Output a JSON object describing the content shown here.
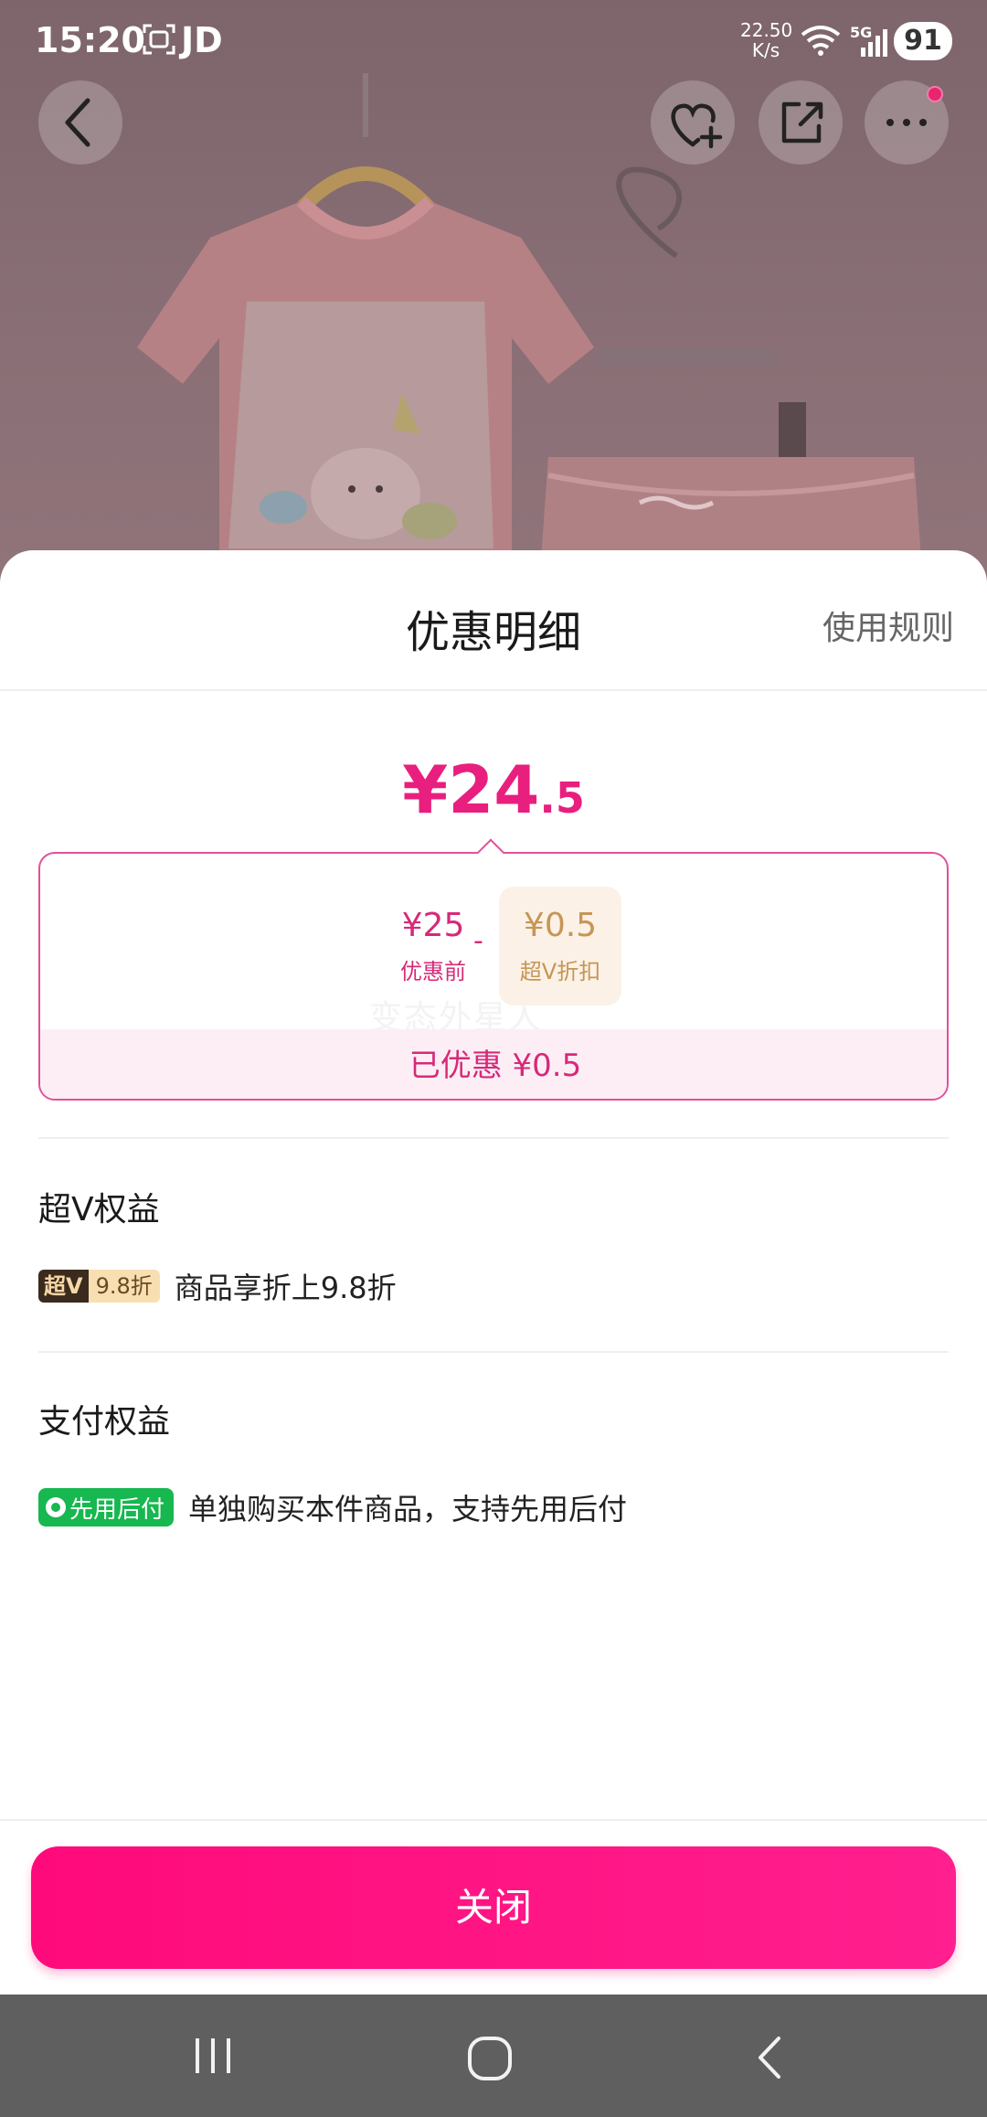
{
  "status_bar": {
    "time": "15:20",
    "carrier": "JD",
    "speed_value": "22.50",
    "speed_unit": "K/s",
    "network": "5G",
    "battery": "91"
  },
  "sheet": {
    "title": "优惠明细",
    "rules_link": "使用规则",
    "final_price_int": "¥24",
    "final_price_dec": ".5",
    "calc": {
      "original_value": "¥25",
      "original_label": "优惠前",
      "minus": "-",
      "discount_value": "¥0.5",
      "discount_label": "超V折扣",
      "watermark": "变态外星人",
      "saved_text": "已优惠 ¥0.5"
    },
    "sections": [
      {
        "title": "超V权益",
        "badge_a": "超V",
        "badge_b": "9.8折",
        "desc": "商品享折上9.8折"
      },
      {
        "title": "支付权益",
        "badge": "先用后付",
        "desc": "单独购买本件商品，支持先用后付"
      }
    ],
    "close_button": "关闭"
  },
  "colors": {
    "accent": "#e81f7e",
    "button": "#ff0a7a",
    "gold": "#c59656",
    "pay_green": "#16b84f"
  }
}
